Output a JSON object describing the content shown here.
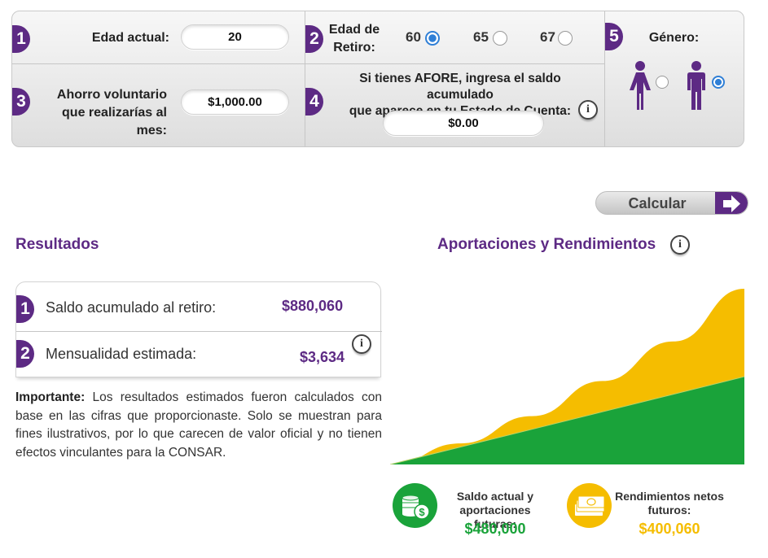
{
  "form": {
    "age": {
      "number": "1",
      "label": "Edad actual:",
      "value": "20"
    },
    "retirement": {
      "number": "2",
      "label_line1": "Edad de",
      "label_line2": "Retiro:",
      "options": [
        {
          "label": "60",
          "selected": true
        },
        {
          "label": "65",
          "selected": false
        },
        {
          "label": "67",
          "selected": false
        }
      ]
    },
    "gender": {
      "number": "5",
      "label": "Género:",
      "female_selected": false,
      "male_selected": true
    },
    "savings": {
      "number": "3",
      "label_line1": "Ahorro voluntario",
      "label_line2": "que realizarías al mes:",
      "value": "$1,000.00"
    },
    "afore": {
      "number": "4",
      "label_line1": "Si tienes AFORE, ingresa el saldo acumulado",
      "label_line2": "que aparece en tu Estado de Cuenta:",
      "value": "$0.00",
      "info_glyph": "i"
    }
  },
  "calculate_button": {
    "label": "Calcular"
  },
  "results": {
    "title": "Resultados",
    "rows": [
      {
        "number": "1",
        "label": "Saldo acumulado al retiro:",
        "value": "$880,060"
      },
      {
        "number": "2",
        "label": "Mensualidad estimada:",
        "value": "$3,634"
      }
    ],
    "info_glyph": "i",
    "note_bold": "Importante:",
    "note_text": " Los resultados estimados fueron calculados con base en las cifras que proporcionaste. Solo se muestran para fines ilustrativos, por lo que carecen de valor oficial y no tienen efectos vinculantes para la CONSAR."
  },
  "chart": {
    "title": "Aportaciones y Rendimientos",
    "info_glyph": "i",
    "colors": {
      "contributions": "#1aa33a",
      "returns": "#f5bd00",
      "purple": "#5d2a84"
    }
  },
  "chart_data": {
    "type": "area",
    "stacked": true,
    "x": [
      0,
      0.2,
      0.4,
      0.6,
      0.8,
      1.0
    ],
    "series": [
      {
        "name": "Saldo actual y aportaciones futuras",
        "values": [
          0,
          0.2,
          0.4,
          0.6,
          0.8,
          1.0
        ]
      },
      {
        "name": "Rendimientos netos futuros",
        "values": [
          0,
          0.04,
          0.15,
          0.35,
          0.6,
          1.0
        ]
      }
    ],
    "totals": {
      "contributions": 480000,
      "returns": 400060
    }
  },
  "legend": [
    {
      "label_line1": "Saldo actual y",
      "label_line2": "aportaciones futuras:",
      "value": "$480,000",
      "icon": "coins-icon",
      "color": "#1aa33a"
    },
    {
      "label_line1": "Rendimientos netos",
      "label_line2": "futuros:",
      "value": "$400,060",
      "icon": "bills-icon",
      "color": "#f5bd00"
    }
  ]
}
